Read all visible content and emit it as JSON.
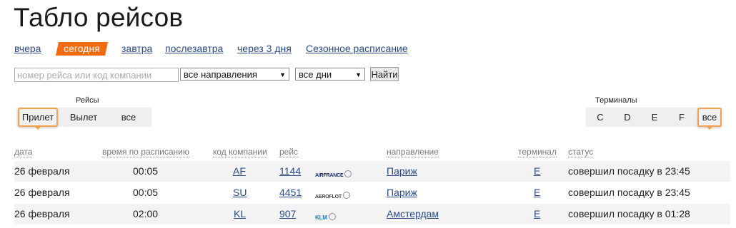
{
  "page": {
    "title": "Табло рейсов"
  },
  "day_nav": {
    "items": [
      "вчера",
      "сегодня",
      "завтра",
      "послезавтра",
      "через 3 дня",
      "Сезонное расписание"
    ],
    "active": "сегодня"
  },
  "filters": {
    "search_placeholder": "номер рейса или код компании",
    "direction_value": "все направления",
    "days_value": "все дни",
    "find_label": "Найти"
  },
  "flights_group": {
    "label": "Рейсы",
    "items": [
      "Прилет",
      "Вылет",
      "все"
    ],
    "active": "Прилет"
  },
  "terminals_group": {
    "label": "Терминалы",
    "items": [
      "C",
      "D",
      "E",
      "F",
      "все"
    ],
    "active": "все"
  },
  "table": {
    "headers": [
      "дата",
      "время по расписанию",
      "код компании",
      "рейс",
      "направление",
      "терминал",
      "статус"
    ],
    "rows": [
      {
        "date": "26 февраля",
        "time": "00:05",
        "code": "AF",
        "flight": "1144",
        "logo": "AIRFRANCE",
        "dest": "Париж",
        "terminal": "E",
        "status": "совершил посадку в 23:45"
      },
      {
        "date": "26 февраля",
        "time": "00:05",
        "code": "SU",
        "flight": "4451",
        "logo": "AEROFLOT",
        "dest": "Париж",
        "terminal": "E",
        "status": "совершил посадку в 23:45"
      },
      {
        "date": "26 февраля",
        "time": "02:00",
        "code": "KL",
        "flight": "907",
        "logo": "KLM",
        "dest": "Амстердам",
        "terminal": "E",
        "status": "совершил посадку в 01:28"
      }
    ]
  },
  "colors": {
    "accent": "#f26b0e",
    "link": "#2a4a8a",
    "active_border": "#f5a04a"
  }
}
